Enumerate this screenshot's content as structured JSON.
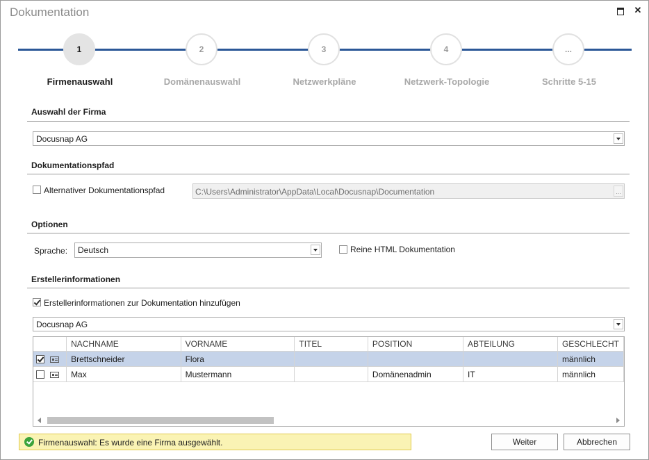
{
  "window": {
    "title": "Dokumentation"
  },
  "steps": [
    {
      "number": "1",
      "label": "Firmenauswahl"
    },
    {
      "number": "2",
      "label": "Domänenauswahl"
    },
    {
      "number": "3",
      "label": "Netzwerkpläne"
    },
    {
      "number": "4",
      "label": "Netzwerk-Topologie"
    },
    {
      "number": "...",
      "label": "Schritte 5-15"
    }
  ],
  "company_section": {
    "heading": "Auswahl der Firma",
    "selected": "Docusnap AG"
  },
  "path_section": {
    "heading": "Dokumentationspfad",
    "alt_path_label": "Alternativer Dokumentationspfad",
    "alt_path_checked": false,
    "path_value": "C:\\Users\\Administrator\\AppData\\Local\\Docusnap\\Documentation",
    "browse_label": "..."
  },
  "options_section": {
    "heading": "Optionen",
    "language_label": "Sprache:",
    "language_value": "Deutsch",
    "html_only_label": "Reine HTML Dokumentation",
    "html_only_checked": false
  },
  "creator_section": {
    "heading": "Erstellerinformationen",
    "add_info_label": "Erstellerinformationen zur Dokumentation hinzufügen",
    "add_info_checked": true,
    "company_selected": "Docusnap AG",
    "columns": [
      "NACHNAME",
      "VORNAME",
      "TITEL",
      "POSITION",
      "ABTEILUNG",
      "GESCHLECHT"
    ],
    "rows": [
      {
        "checked": true,
        "selected": true,
        "cells": [
          "Brettschneider",
          "Flora",
          "",
          "",
          "",
          "männlich"
        ]
      },
      {
        "checked": false,
        "selected": false,
        "cells": [
          "Max",
          "Mustermann",
          "",
          "Domänenadmin",
          "IT",
          "männlich"
        ]
      }
    ]
  },
  "status": {
    "text": "Firmenauswahl: Es wurde eine Firma ausgewählt."
  },
  "buttons": {
    "next": "Weiter",
    "cancel": "Abbrechen"
  },
  "icons": [
    "maximize-icon",
    "close-icon",
    "dropdown-arrow-icon",
    "contact-card-icon",
    "success-check-icon",
    "scroll-left-icon",
    "scroll-right-icon"
  ]
}
